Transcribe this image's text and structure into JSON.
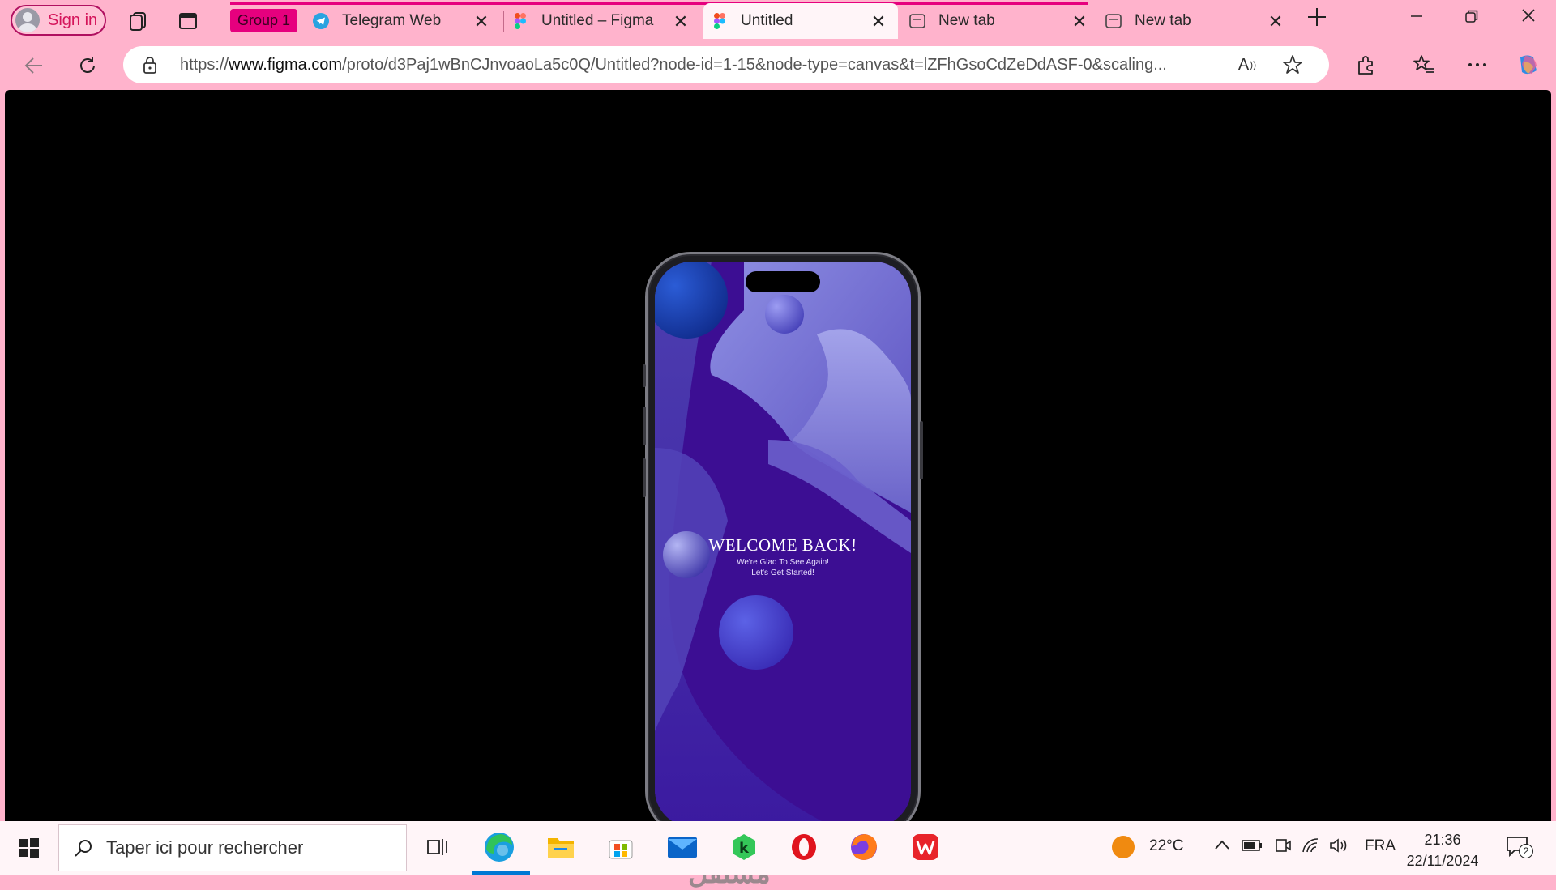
{
  "browser": {
    "sign_in_label": "Sign in",
    "group_label": "Group 1",
    "tabs": [
      {
        "label": "Telegram Web",
        "icon": "telegram-icon"
      },
      {
        "label": "Untitled – Figma",
        "icon": "figma-icon"
      },
      {
        "label": "Untitled",
        "icon": "figma-icon",
        "active": true
      },
      {
        "label": "New tab",
        "icon": "newtab-icon"
      },
      {
        "label": "New tab",
        "icon": "newtab-icon"
      }
    ],
    "url_prefix": "https://",
    "url_host": "www.figma.com",
    "url_path": "/proto/d3Paj1wBnCJnvoaoLa5c0Q/Untitled?node-id=1-15&node-type=canvas&t=lZFhGsoCdZeDdASF-0&scaling...",
    "read_aloud_label": "A"
  },
  "prototype": {
    "title": "WELCOME BACK!",
    "line1": "We're Glad To See Again!",
    "line2": "Let's Get Started!"
  },
  "watermark": "مستقل",
  "taskbar": {
    "search_placeholder": "Taper ici pour rechercher",
    "weather_temp": "22°C",
    "language": "FRA",
    "time": "21:36",
    "date": "22/11/2024",
    "notification_count": "2"
  },
  "colors": {
    "browser_chrome": "#ffb3cc",
    "group_accent": "#e6007e",
    "screen_bg": "#3c0e93"
  }
}
